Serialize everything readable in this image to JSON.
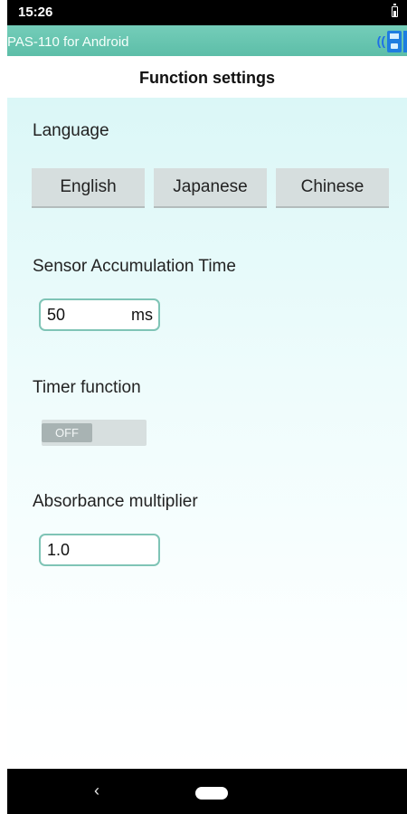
{
  "status_bar": {
    "time": "15:26",
    "battery_icon": "battery-icon"
  },
  "app_bar": {
    "title": "PAS-110 for Android",
    "icons": [
      "wireless-signal-icon",
      "device-icon"
    ]
  },
  "page": {
    "title": "Function settings"
  },
  "language": {
    "label": "Language",
    "options": [
      "English",
      "Japanese",
      "Chinese"
    ]
  },
  "sensor_accumulation": {
    "label": "Sensor Accumulation Time",
    "value": "50",
    "unit": "ms"
  },
  "timer": {
    "label": "Timer function",
    "state_text": "OFF"
  },
  "absorbance": {
    "label": "Absorbance multiplier",
    "value": "1.0"
  },
  "nav_bar": {
    "back_glyph": "‹",
    "icons": [
      "back-icon",
      "home-icon"
    ]
  },
  "colors": {
    "app_bar": "#5dbea8",
    "field_border": "#7fc4b6",
    "button_bg": "#d6dede",
    "device_icon": "#1e7de0"
  }
}
